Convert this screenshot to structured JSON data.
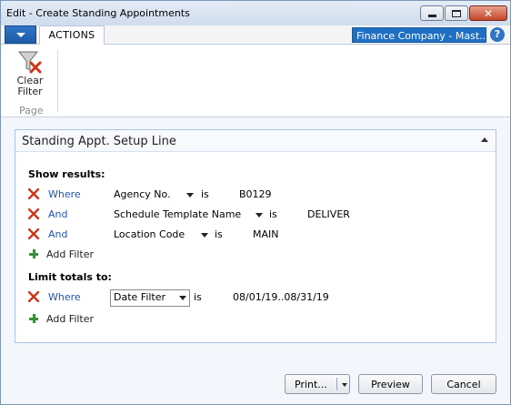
{
  "window": {
    "title": "Edit - Create Standing Appointments",
    "close_glyph": "✕"
  },
  "ribbon": {
    "tab_actions": "ACTIONS",
    "company": "Finance Company - Mast...",
    "help_glyph": "?",
    "clear_filter_line1": "Clear",
    "clear_filter_line2": "Filter",
    "group_label": "Page"
  },
  "fasttab": {
    "title": "Standing Appt. Setup Line",
    "show_results_label": "Show results:",
    "filters": [
      {
        "conj": "Where",
        "field": "Agency No.",
        "op": "is",
        "value": "B0129"
      },
      {
        "conj": "And",
        "field": "Schedule Template Name",
        "op": "is",
        "value": "DELIVER"
      },
      {
        "conj": "And",
        "field": "Location Code",
        "op": "is",
        "value": "MAIN"
      }
    ],
    "add_filter_label": "Add Filter",
    "limit_totals_label": "Limit totals to:",
    "limit_filters": [
      {
        "conj": "Where",
        "field": "Date Filter",
        "op": "is",
        "value": "08/01/19..08/31/19"
      }
    ],
    "add_filter_label_2": "Add Filter"
  },
  "footer": {
    "print_label": "Print...",
    "preview_label": "Preview",
    "cancel_label": "Cancel"
  }
}
